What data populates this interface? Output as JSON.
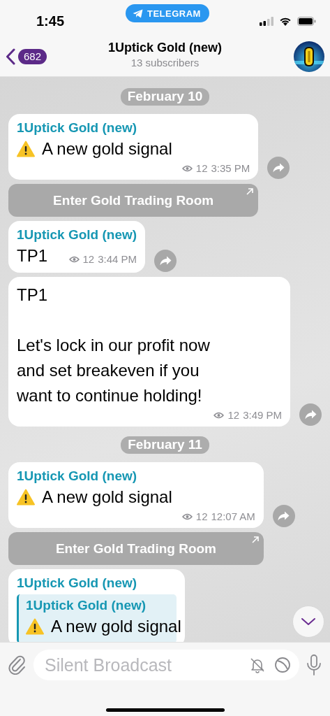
{
  "status_bar": {
    "time": "1:45",
    "app_pill": "TELEGRAM"
  },
  "header": {
    "back_badge": "682",
    "title": "1Uptick Gold (new)",
    "subtitle": "13 subscribers"
  },
  "messages": [
    {
      "kind": "date",
      "text": "February 10"
    },
    {
      "kind": "message",
      "sender": "1Uptick Gold (new)",
      "warning": true,
      "body": "A new gold signal",
      "views": "12",
      "time": "3:35 PM",
      "button": "Enter Gold Trading Room"
    },
    {
      "kind": "message",
      "sender": "1Uptick Gold (new)",
      "warning": false,
      "body": "TP1",
      "views": "12",
      "time": "3:44 PM"
    },
    {
      "kind": "message",
      "warning": false,
      "body": "TP1\n\nLet's lock in our profit now\nand set breakeven if you\nwant to continue holding!",
      "views": "12",
      "time": "3:49 PM"
    },
    {
      "kind": "date",
      "text": "February 11"
    },
    {
      "kind": "message",
      "sender": "1Uptick Gold (new)",
      "warning": true,
      "body": "A new gold signal",
      "views": "12",
      "time": "12:07 AM",
      "button": "Enter Gold Trading Room"
    },
    {
      "kind": "message",
      "sender": "1Uptick Gold (new)",
      "quote": {
        "sender": "1Uptick Gold (new)",
        "warning": true,
        "body": "A new gold signal"
      }
    }
  ],
  "composer": {
    "placeholder": "Silent Broadcast"
  }
}
